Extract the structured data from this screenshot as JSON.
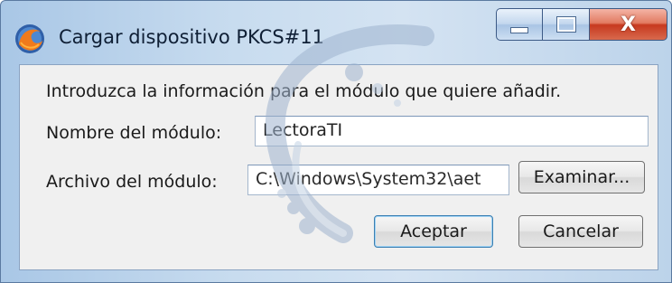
{
  "window": {
    "title": "Cargar dispositivo PKCS#11",
    "icon": "firefox-icon",
    "caption_buttons": {
      "minimize_icon": "minimize-icon",
      "maximize_icon": "maximize-icon",
      "close_glyph": "X"
    }
  },
  "dialog": {
    "instruction": "Introduzca la información para el módulo que quiere añadir.",
    "module_name": {
      "label": "Nombre del módulo:",
      "value": "LectoraTI"
    },
    "module_file": {
      "label": "Archivo del módulo:",
      "value": "C:\\Windows\\System32\\aet"
    },
    "browse_button": "Examinar...",
    "accept_button": "Aceptar",
    "cancel_button": "Cancelar"
  },
  "colors": {
    "title_bar": "#c8dcef",
    "close_button": "#c7391f",
    "client_bg": "#f0f0f0",
    "default_button_border": "#3c7fb1"
  }
}
